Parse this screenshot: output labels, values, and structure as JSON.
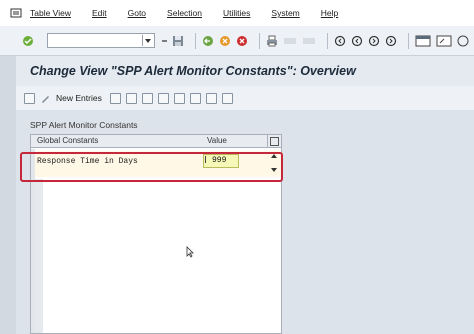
{
  "menubar": {
    "items": [
      "Table View",
      "Edit",
      "Goto",
      "Selection",
      "Utilities",
      "System",
      "Help"
    ],
    "first_icon": "menu-icon"
  },
  "toolbar": {
    "command_value": "",
    "icons": [
      "enter-icon",
      "save-icon",
      "back-icon",
      "exit-icon",
      "cancel-icon",
      "print-icon",
      "find-icon",
      "find-next-icon",
      "first-page-icon",
      "previous-page-icon",
      "next-page-icon",
      "last-page-icon",
      "new-session-icon",
      "shortcut-icon",
      "help-icon"
    ]
  },
  "title": "Change View \"SPP Alert Monitor Constants\": Overview",
  "app_toolbar": {
    "new_entries_label": "New Entries"
  },
  "group_title": "SPP Alert Monitor Constants",
  "table": {
    "columns": [
      "Global Constants",
      "Value"
    ],
    "rows": [
      {
        "label": "Response Time in Days",
        "value": "999"
      }
    ]
  },
  "colors": {
    "highlight_outline": "#c4283a",
    "input_bg": "#f6f8b8"
  }
}
